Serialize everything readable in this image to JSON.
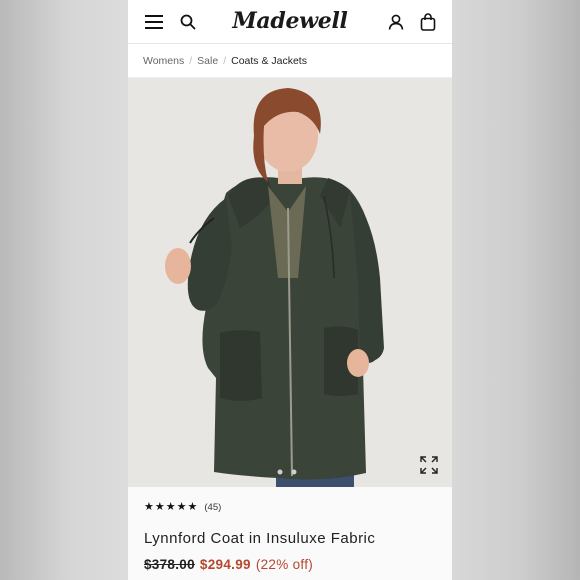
{
  "header": {
    "logo_text": "Madewell",
    "icons": [
      "menu-icon",
      "search-icon",
      "account-icon",
      "bag-icon"
    ]
  },
  "breadcrumb": {
    "items": [
      "Womens",
      "Sale",
      "Coats & Jackets"
    ],
    "separator": "/"
  },
  "product": {
    "rating_stars": 4.5,
    "review_count": "(45)",
    "title": "Lynnford Coat in Insuluxe Fabric",
    "original_price": "$378.00",
    "sale_price": "$294.99",
    "discount": "(22% off)"
  },
  "colors": {
    "coat": "#3b4439",
    "sale_red": "#b5482e",
    "background": "#e7e6e2"
  }
}
